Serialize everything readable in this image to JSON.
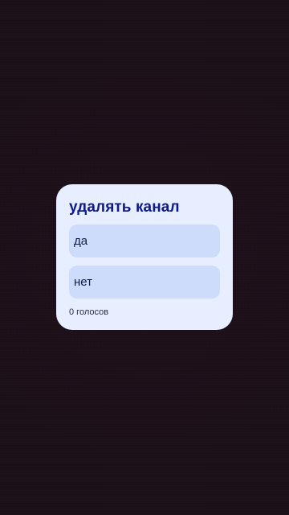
{
  "poll": {
    "title": "удалять канал",
    "options": [
      {
        "label": "да"
      },
      {
        "label": "нет"
      }
    ],
    "vote_count": "0 голосов"
  },
  "colors": {
    "background": "#1b0f18",
    "card": "#e7eeff",
    "option": "#cddcfb",
    "title": "#0d1a8a"
  }
}
